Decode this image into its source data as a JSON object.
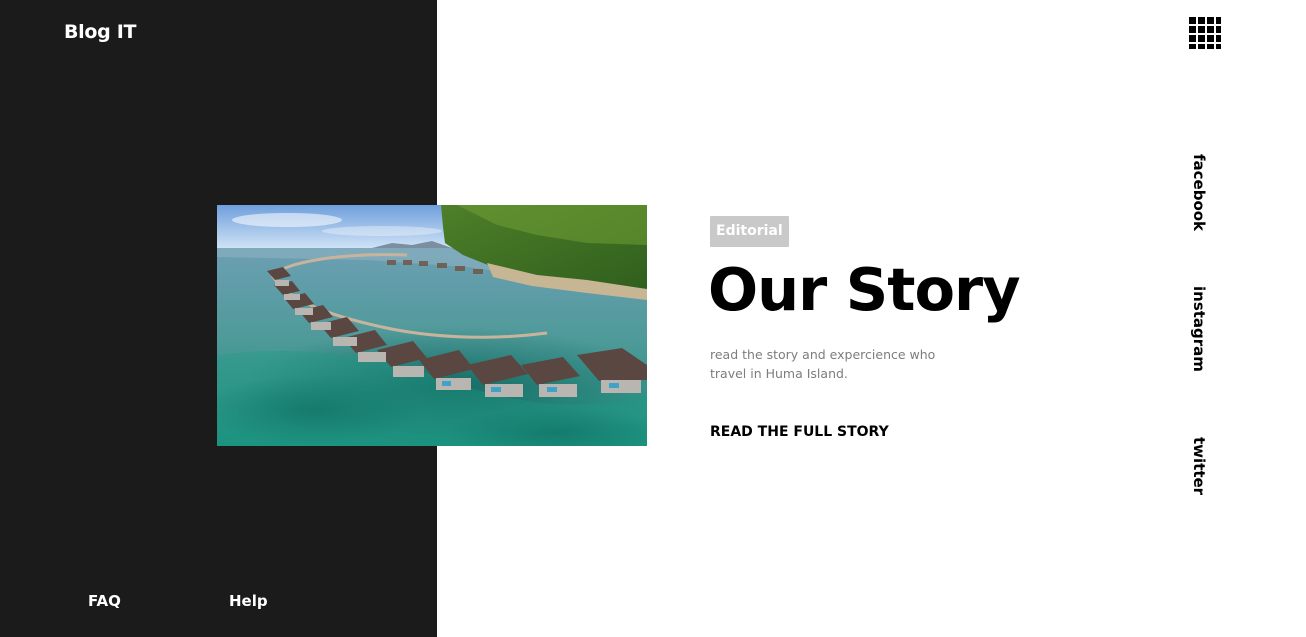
{
  "brand": {
    "name": "Blog IT"
  },
  "footer": {
    "links": [
      {
        "label": "FAQ"
      },
      {
        "label": "Help"
      }
    ]
  },
  "menu": {
    "icon": "grid-menu-icon"
  },
  "hero": {
    "image": {
      "icon": "resort-photo",
      "alt": ""
    },
    "tag": "Editorial",
    "title": "Our Story",
    "description": "read the story and expercience who travel in Huma Island.",
    "cta_label": "READ THE FULL STORY"
  },
  "social": {
    "links": [
      {
        "label": "facebook"
      },
      {
        "label": "instagram"
      },
      {
        "label": "twitter"
      }
    ]
  },
  "colors": {
    "left_panel": "#1b1b1b",
    "tag_background": "#c9c9c9",
    "headline": "#000000",
    "description": "#7d7d7d"
  }
}
